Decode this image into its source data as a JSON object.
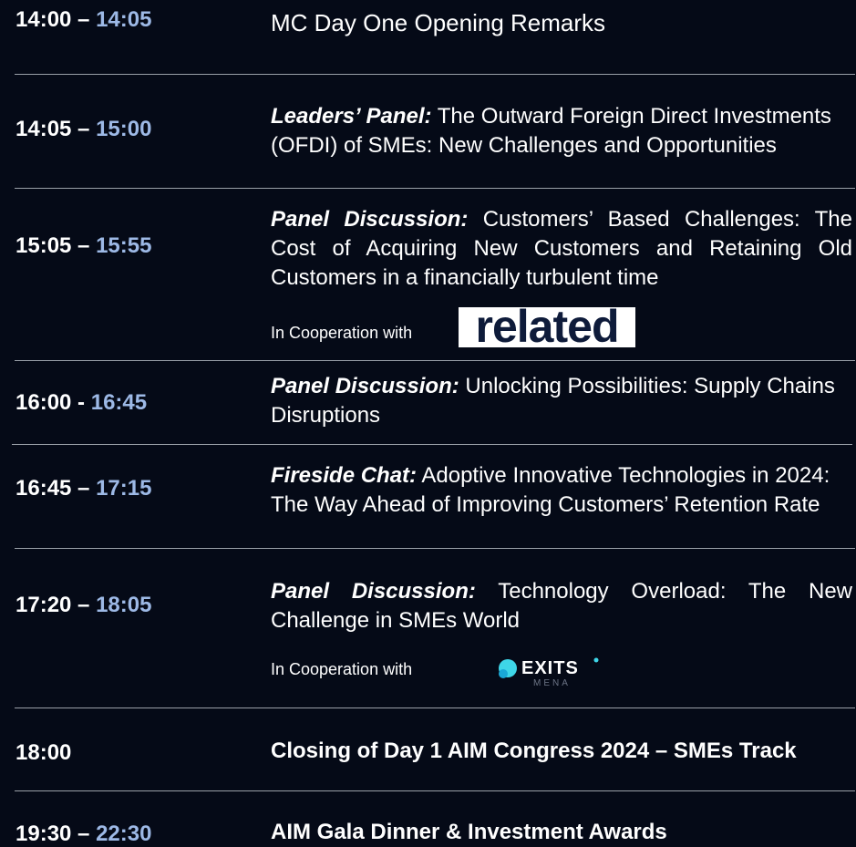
{
  "sessions": [
    {
      "start": "14:00",
      "sep": " – ",
      "end": "14:05",
      "label": "",
      "title": "MC Day One Opening Remarks"
    },
    {
      "start": "14:05",
      "sep": " – ",
      "end": "15:00",
      "label": "Leaders’ Panel:",
      "title": " The Outward Foreign Direct Investments (OFDI) of SMEs: New Challenges and Opportunities"
    },
    {
      "start": "15:05",
      "sep": " – ",
      "end": "15:55",
      "label": "Panel Discussion:",
      "title": " Customers’ Based Challenges: The Cost of Acquiring New Customers and Retaining Old Customers in a financially turbulent time",
      "cooperation": "In Cooperation with",
      "partner_logo": "related"
    },
    {
      "start": "16:00",
      "sep": " - ",
      "end": "16:45",
      "label": "Panel Discussion:",
      "title": " Unlocking Possibilities: Supply Chains Disruptions"
    },
    {
      "start": "16:45",
      "sep": " – ",
      "end": "17:15",
      "label": "Fireside Chat:",
      "title": " Adoptive Innovative Technologies in 2024: The Way Ahead of Improving Customers’ Retention Rate"
    },
    {
      "start": "17:20",
      "sep": " – ",
      "end": "18:05",
      "label": "Panel Discussion:",
      "title": " Technology Overload: The New Challenge in SMEs World",
      "cooperation": "In Cooperation with",
      "partner_logo": "EXITS MENA"
    },
    {
      "start": "18:00",
      "title": "Closing of  Day 1 AIM Congress 2024 – SMEs Track"
    },
    {
      "start": "19:30",
      "sep": " – ",
      "end": "22:30",
      "title": "AIM Gala Dinner & Investment Awards"
    }
  ],
  "logos": {
    "related_text": "related",
    "exits_text": "EXITS",
    "exits_sub": "MENA"
  },
  "colors": {
    "background": "#050a17",
    "accent_time": "#9db9e6",
    "divider": "#9aa0a8"
  }
}
